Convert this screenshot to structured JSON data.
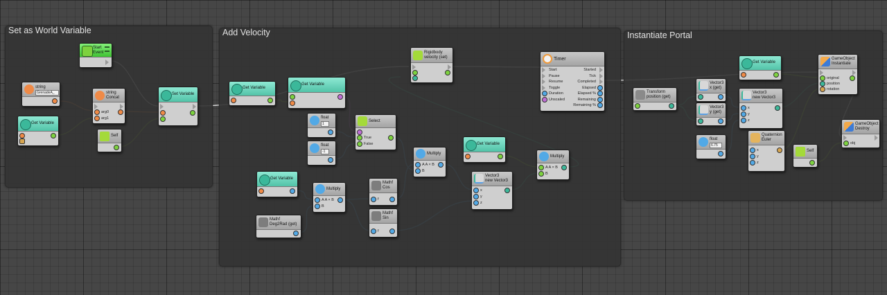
{
  "groups": {
    "g1": "Set as World Variable",
    "g2": "Add Velocity",
    "g3": "Instantiate Portal"
  },
  "nodes": {
    "start_event": {
      "line1": "Start",
      "line2": "Event"
    },
    "string_node": {
      "title": "string",
      "value": "GrenadeA_"
    },
    "concat": {
      "line1": "string",
      "line2": "Concat",
      "arg0": "arg0",
      "arg1": "arg1"
    },
    "get_var_1": {
      "title": "Get Variable"
    },
    "self_1": {
      "title": "Self"
    },
    "set_var": {
      "title": "Set Variable"
    },
    "get_var_2": {
      "title": "Get Variable"
    },
    "get_var_3": {
      "title": "Get Variable"
    },
    "rigidbody": {
      "line1": "Rigidbody",
      "line2": "velocity (set)"
    },
    "timer": {
      "title": "Timer",
      "inputs": [
        "Start",
        "Pause",
        "Resume",
        "Toggle",
        "Duration",
        "Unscaled"
      ],
      "outputs": [
        "Started",
        "Tick",
        "Completed",
        "Elapsed",
        "Elapsed %",
        "Remaining",
        "Remaining %"
      ]
    },
    "float_1": {
      "title": "float",
      "value": "1"
    },
    "float_2": {
      "title": "float",
      "value": "-1"
    },
    "select": {
      "title": "Select",
      "true_label": "True",
      "false_label": "False"
    },
    "multiply_1": {
      "title": "Multiply",
      "label": "A  A × B",
      "b": "B"
    },
    "get_var_4": {
      "title": "Get Variable"
    },
    "multiply_2": {
      "title": "Multiply",
      "label": "A  A × B",
      "b": "B"
    },
    "get_var_5": {
      "title": "Get Variable"
    },
    "multiply_3": {
      "title": "Multiply",
      "label": "A  A × B",
      "b": "B"
    },
    "cos": {
      "line1": "Mathf",
      "line2": "Cos",
      "f": "f"
    },
    "sin": {
      "line1": "Mathf",
      "line2": "Sin",
      "f": "f"
    },
    "vec3_1": {
      "line1": "Vector3",
      "line2": "new Vector3",
      "x": "x",
      "y": "y",
      "z": "z"
    },
    "deg2rad": {
      "line1": "Mathf",
      "line2": "Deg2Rad (get)"
    },
    "transform_pos": {
      "line1": "Transform",
      "line2": "position (get)"
    },
    "vec3_x": {
      "line1": "Vector3",
      "line2": "x (get)"
    },
    "vec3_y": {
      "line1": "Vector3",
      "line2": "y (get)"
    },
    "float_3": {
      "title": "float",
      "value": "6.75"
    },
    "get_var_6": {
      "title": "Get Variable"
    },
    "vec3_2": {
      "line1": "Vector3",
      "line2": "new Vector3",
      "x": "x",
      "y": "y",
      "z": "z"
    },
    "quaternion": {
      "line1": "Quaternion",
      "line2": "Euler",
      "x": "x",
      "y": "y",
      "z": "z"
    },
    "self_2": {
      "title": "Self"
    },
    "instantiate": {
      "line1": "GameObject",
      "line2": "Instantiate",
      "original": "original",
      "position": "position",
      "rotation": "rotation"
    },
    "destroy": {
      "line1": "GameObject",
      "line2": "Destroy",
      "obj": "obj"
    }
  },
  "colors": {
    "control_wire": "#e6e6e6",
    "float_wire": "#5ab0ea",
    "string_wire": "#f08a4b",
    "object_wire": "#9ad33c",
    "vector_wire": "#4fbe9a",
    "bool_wire": "#c06fd6",
    "group_bg": "#343434",
    "grid_bg": "#464646",
    "header_teal": "#5fcbb1",
    "header_grey": "#b0b0b0",
    "header_green": "#52d045"
  }
}
